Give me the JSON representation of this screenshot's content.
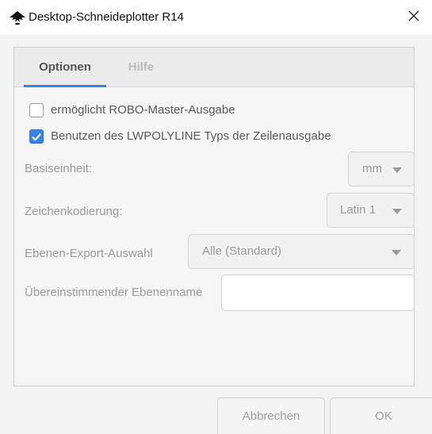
{
  "window": {
    "title": "Desktop-Schneideplotter R14",
    "app_icon": "inkscape-icon",
    "close_icon": "close-icon"
  },
  "tabs": [
    {
      "label": "Optionen",
      "active": true
    },
    {
      "label": "Hilfe",
      "active": false
    }
  ],
  "options": {
    "robo_master": {
      "label": "ermöglicht ROBO-Master-Ausgabe",
      "checked": false
    },
    "lwpolyline": {
      "label": "Benutzen des LWPOLYLINE Typs der Zeilenausgabe",
      "checked": true
    },
    "base_unit": {
      "label": "Basiseinheit:",
      "value": "mm"
    },
    "encoding": {
      "label": "Zeichenkodierung:",
      "value": "Latin 1"
    },
    "layer_export": {
      "label": "Ebenen-Export-Auswahl",
      "value": "Alle (Standard)"
    },
    "layer_name": {
      "label": "Übereinstimmender Ebenenname",
      "value": "",
      "placeholder": ""
    }
  },
  "buttons": {
    "cancel": "Abbrechen",
    "ok": "OK"
  },
  "colors": {
    "accent": "#3584e4"
  }
}
